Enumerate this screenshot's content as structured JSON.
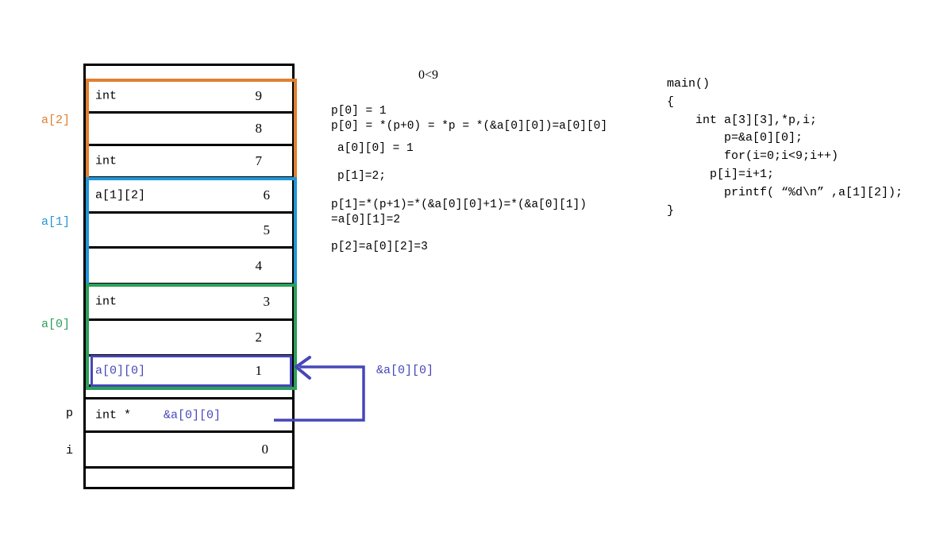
{
  "memory": {
    "rows": [
      {
        "name": "spacer-top",
        "type": "",
        "value": "",
        "type_color": "black"
      },
      {
        "name": "a2-2",
        "type": "int",
        "value": "9",
        "type_color": "black"
      },
      {
        "name": "a2-1",
        "type": "",
        "value": "8",
        "type_color": "black"
      },
      {
        "name": "a2-0",
        "type": "int",
        "value": "7",
        "type_color": "black"
      },
      {
        "name": "a1-2",
        "type": "a[1][2]",
        "value": "6",
        "type_color": "black"
      },
      {
        "name": "a1-1",
        "type": "",
        "value": "5",
        "type_color": "black"
      },
      {
        "name": "a1-0",
        "type": "",
        "value": "4",
        "type_color": "black"
      },
      {
        "name": "a0-2",
        "type": "int",
        "value": "3",
        "type_color": "black"
      },
      {
        "name": "a0-1",
        "type": "",
        "value": "2",
        "type_color": "black"
      },
      {
        "name": "a0-0",
        "type": "a[0][0]",
        "value": "1",
        "type_color": "blue"
      },
      {
        "name": "p-row",
        "type": "int *",
        "value": "",
        "type_color": "black"
      },
      {
        "name": "i-row",
        "type": "",
        "value": "0",
        "type_color": "black"
      },
      {
        "name": "spacer-bot",
        "type": "",
        "value": "",
        "type_color": "black"
      }
    ],
    "pointer_row_value": "&a[0][0]",
    "groups": [
      {
        "key": "a2",
        "label": "a[2]",
        "color": "#e08030"
      },
      {
        "key": "a1",
        "label": "a[1]",
        "color": "#2196d6"
      },
      {
        "key": "a0",
        "label": "a[0]",
        "color": "#2ca05a"
      },
      {
        "key": "a00",
        "label": "",
        "color": "#4747b8"
      }
    ],
    "side_labels": [
      {
        "key": "p",
        "label": "p"
      },
      {
        "key": "i",
        "label": "i"
      }
    ]
  },
  "arrow": {
    "label": "&a[0][0]",
    "color": "#4747b8"
  },
  "notes": {
    "loop_condition": "0<9",
    "lines": [
      {
        "text": "p[0] = 1",
        "indent": 0,
        "gap": 0
      },
      {
        "text": "p[0] = *(p+0) = *p = *(&a[0][0])=a[0][0]",
        "indent": 0,
        "gap": 4
      },
      {
        "text": "a[0][0] = 1",
        "indent": 8,
        "gap": 14
      },
      {
        "text": "p[1]=2;",
        "indent": 8,
        "gap": 20
      },
      {
        "text": "p[1]=*(p+1)=*(&a[0][0]+1)=*(&a[0][1])",
        "indent": 0,
        "gap": 22
      },
      {
        "text": "=a[0][1]=2",
        "indent": 0,
        "gap": 4
      },
      {
        "text": "p[2]=a[0][2]=3",
        "indent": 0,
        "gap": 20
      }
    ]
  },
  "code": {
    "lines": [
      "main()",
      "{",
      "    int a[3][3],*p,i;",
      "        p=&a[0][0];",
      "        for(i=0;i<9;i++)",
      "      p[i]=i+1;",
      "        printf( “%d\\n” ,a[1][2]);",
      "}"
    ]
  },
  "colors": {
    "a2_orange": "#e08030",
    "a1_blue": "#2196d6",
    "a0_green": "#2ca05a",
    "pointer_blue": "#4747b8",
    "outline_black": "#000000"
  }
}
